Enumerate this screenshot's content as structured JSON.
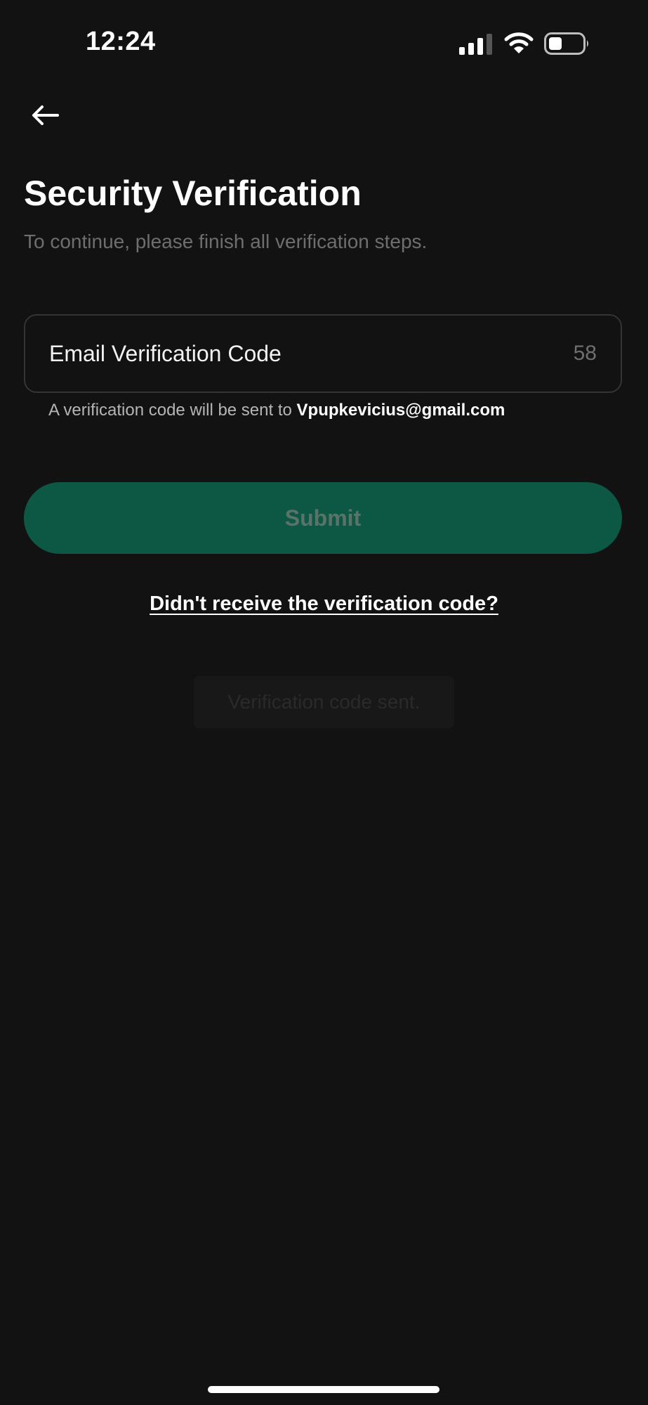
{
  "status_bar": {
    "time": "12:24",
    "icons": [
      "signal-icon",
      "wifi-icon",
      "battery-icon"
    ]
  },
  "header": {
    "back_icon": "arrow-left-icon"
  },
  "main": {
    "title": "Security Verification",
    "subtitle": "To continue, please finish all verification steps.",
    "code_field": {
      "placeholder": "Email Verification Code",
      "value": "",
      "countdown": "58"
    },
    "helper": {
      "prefix": "A verification code will be sent to ",
      "email": "Vpupkevicius@gmail.com"
    },
    "submit_label": "Submit",
    "resend_link": "Didn't receive the verification code?",
    "toast": "Verification code sent."
  },
  "colors": {
    "background": "#121212",
    "accent": "#0c5845",
    "muted_text": "#6e6e6e",
    "field_border": "#343434"
  }
}
